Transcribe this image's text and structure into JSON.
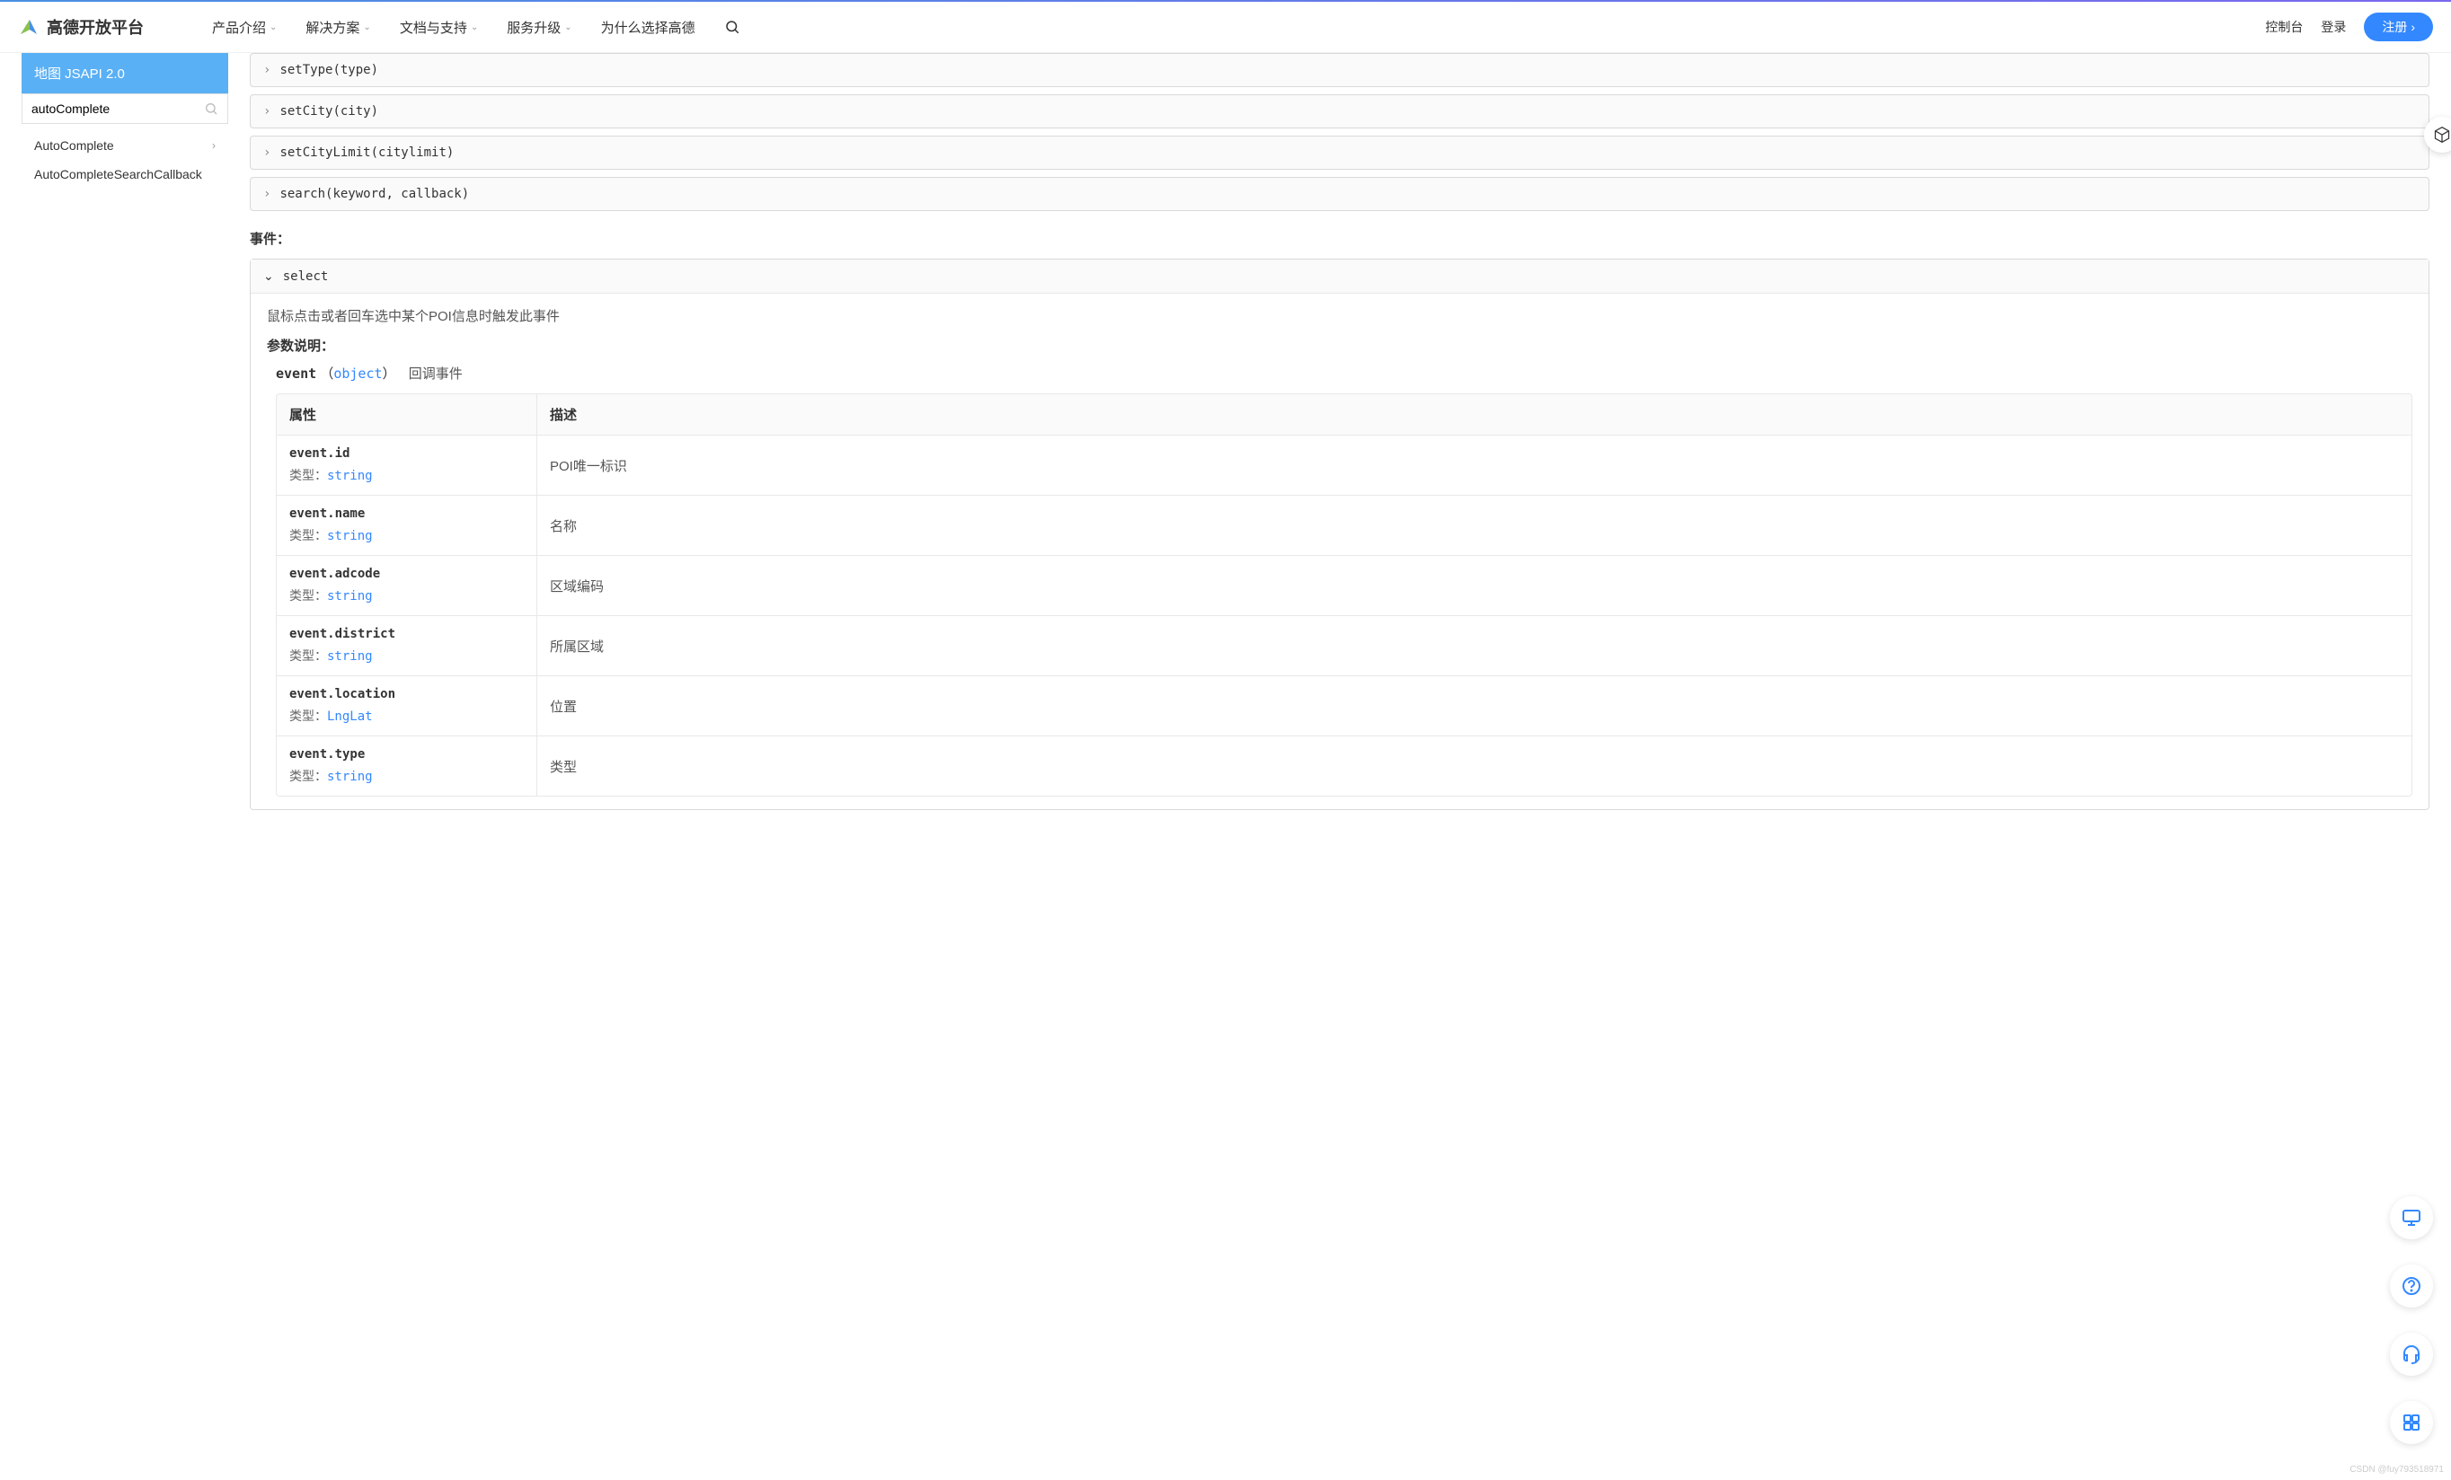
{
  "header": {
    "brand": "高德开放平台",
    "nav": [
      "产品介绍",
      "解决方案",
      "文档与支持",
      "服务升级",
      "为什么选择高德"
    ],
    "console": "控制台",
    "login": "登录",
    "signup": "注册"
  },
  "sidebar": {
    "title": "地图 JSAPI 2.0",
    "search_value": "autoComplete",
    "items": [
      "AutoComplete",
      "AutoCompleteSearchCallback"
    ]
  },
  "methods": [
    "setType(type)",
    "setCity(city)",
    "setCityLimit(citylimit)",
    "search(keyword, callback)"
  ],
  "events_label": "事件：",
  "event": {
    "name": "select",
    "description": "鼠标点击或者回车选中某个POI信息时触发此事件",
    "param_title": "参数说明：",
    "param_name": "event",
    "param_type": "object",
    "param_desc": "回调事件",
    "table_head": {
      "attr": "属性",
      "desc": "描述"
    },
    "type_label": "类型：",
    "props": [
      {
        "name": "event.id",
        "type": "string",
        "desc": "POI唯一标识"
      },
      {
        "name": "event.name",
        "type": "string",
        "desc": "名称"
      },
      {
        "name": "event.adcode",
        "type": "string",
        "desc": "区域编码"
      },
      {
        "name": "event.district",
        "type": "string",
        "desc": "所属区域"
      },
      {
        "name": "event.location",
        "type": "LngLat",
        "desc": "位置"
      },
      {
        "name": "event.type",
        "type": "string",
        "desc": "类型"
      }
    ]
  },
  "watermark": "CSDN @fuy793518971"
}
